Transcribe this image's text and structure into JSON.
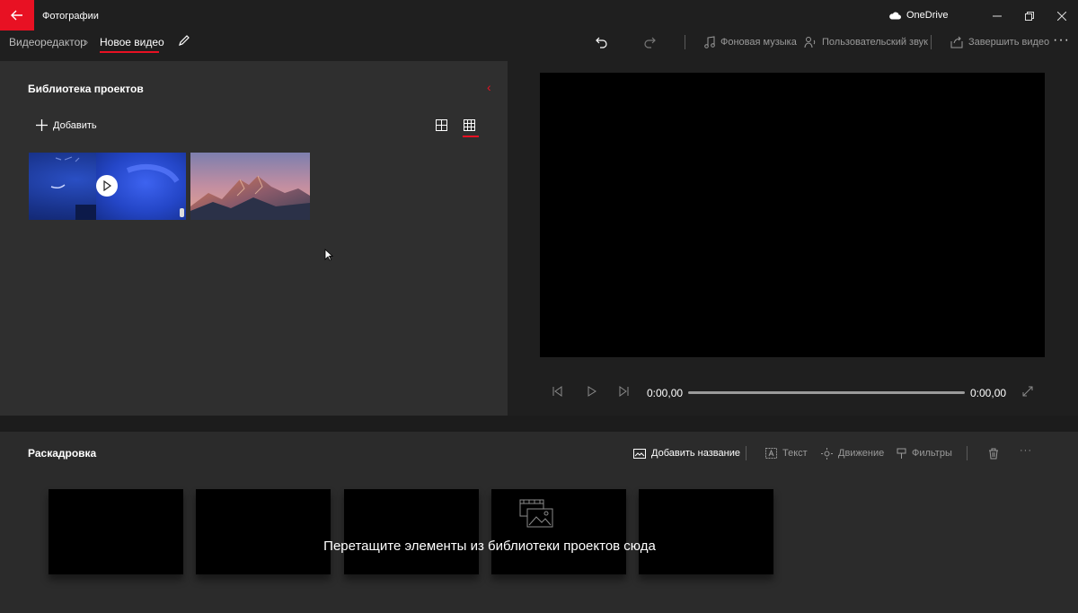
{
  "app": {
    "title": "Фотографии",
    "onedrive_label": "OneDrive"
  },
  "breadcrumb": {
    "root": "Видеоредактор",
    "current": "Новое видео"
  },
  "toolbar": {
    "background_music": "Фоновая музыка",
    "custom_audio": "Пользовательский звук",
    "finish_video": "Завершить видео"
  },
  "library": {
    "title": "Библиотека проектов",
    "add_label": "Добавить",
    "items": [
      {
        "kind": "video",
        "description": "blue video clip"
      },
      {
        "kind": "image",
        "description": "mountain sunset"
      }
    ]
  },
  "player": {
    "current_time": "0:00,00",
    "total_time": "0:00,00",
    "progress": 0
  },
  "storyboard": {
    "title": "Раскадровка",
    "add_title": "Добавить название",
    "text": "Текст",
    "motion": "Движение",
    "filters": "Фильтры",
    "drop_hint": "Перетащите элементы из библиотеки проектов сюда"
  },
  "colors": {
    "accent": "#e81123",
    "background": "#1f1f1f",
    "panel": "#2f2f2f"
  }
}
